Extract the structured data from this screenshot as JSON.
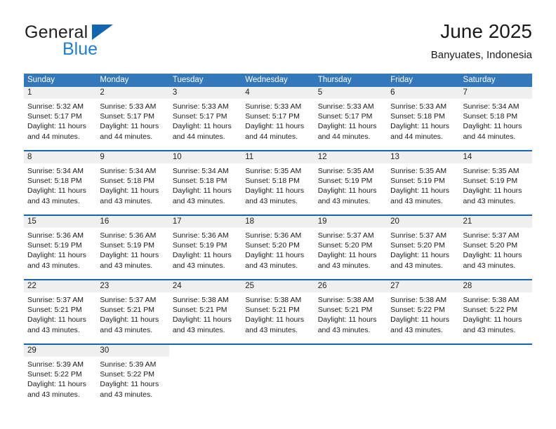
{
  "brand": {
    "name_part1": "General",
    "name_part2": "Blue",
    "flag_icon": "triangle-flag-icon"
  },
  "header": {
    "title": "June 2025",
    "location": "Banyuates, Indonesia"
  },
  "calendar": {
    "weekday_headers": [
      "Sunday",
      "Monday",
      "Tuesday",
      "Wednesday",
      "Thursday",
      "Friday",
      "Saturday"
    ],
    "accent_color": "#3478bc",
    "row_border_color": "#1266b0",
    "daynum_bg_color": "#efefef",
    "weeks": [
      [
        {
          "day": "1",
          "sunrise": "Sunrise: 5:32 AM",
          "sunset": "Sunset: 5:17 PM",
          "daylight": "Daylight: 11 hours and 44 minutes."
        },
        {
          "day": "2",
          "sunrise": "Sunrise: 5:33 AM",
          "sunset": "Sunset: 5:17 PM",
          "daylight": "Daylight: 11 hours and 44 minutes."
        },
        {
          "day": "3",
          "sunrise": "Sunrise: 5:33 AM",
          "sunset": "Sunset: 5:17 PM",
          "daylight": "Daylight: 11 hours and 44 minutes."
        },
        {
          "day": "4",
          "sunrise": "Sunrise: 5:33 AM",
          "sunset": "Sunset: 5:17 PM",
          "daylight": "Daylight: 11 hours and 44 minutes."
        },
        {
          "day": "5",
          "sunrise": "Sunrise: 5:33 AM",
          "sunset": "Sunset: 5:17 PM",
          "daylight": "Daylight: 11 hours and 44 minutes."
        },
        {
          "day": "6",
          "sunrise": "Sunrise: 5:33 AM",
          "sunset": "Sunset: 5:18 PM",
          "daylight": "Daylight: 11 hours and 44 minutes."
        },
        {
          "day": "7",
          "sunrise": "Sunrise: 5:34 AM",
          "sunset": "Sunset: 5:18 PM",
          "daylight": "Daylight: 11 hours and 44 minutes."
        }
      ],
      [
        {
          "day": "8",
          "sunrise": "Sunrise: 5:34 AM",
          "sunset": "Sunset: 5:18 PM",
          "daylight": "Daylight: 11 hours and 43 minutes."
        },
        {
          "day": "9",
          "sunrise": "Sunrise: 5:34 AM",
          "sunset": "Sunset: 5:18 PM",
          "daylight": "Daylight: 11 hours and 43 minutes."
        },
        {
          "day": "10",
          "sunrise": "Sunrise: 5:34 AM",
          "sunset": "Sunset: 5:18 PM",
          "daylight": "Daylight: 11 hours and 43 minutes."
        },
        {
          "day": "11",
          "sunrise": "Sunrise: 5:35 AM",
          "sunset": "Sunset: 5:18 PM",
          "daylight": "Daylight: 11 hours and 43 minutes."
        },
        {
          "day": "12",
          "sunrise": "Sunrise: 5:35 AM",
          "sunset": "Sunset: 5:19 PM",
          "daylight": "Daylight: 11 hours and 43 minutes."
        },
        {
          "day": "13",
          "sunrise": "Sunrise: 5:35 AM",
          "sunset": "Sunset: 5:19 PM",
          "daylight": "Daylight: 11 hours and 43 minutes."
        },
        {
          "day": "14",
          "sunrise": "Sunrise: 5:35 AM",
          "sunset": "Sunset: 5:19 PM",
          "daylight": "Daylight: 11 hours and 43 minutes."
        }
      ],
      [
        {
          "day": "15",
          "sunrise": "Sunrise: 5:36 AM",
          "sunset": "Sunset: 5:19 PM",
          "daylight": "Daylight: 11 hours and 43 minutes."
        },
        {
          "day": "16",
          "sunrise": "Sunrise: 5:36 AM",
          "sunset": "Sunset: 5:19 PM",
          "daylight": "Daylight: 11 hours and 43 minutes."
        },
        {
          "day": "17",
          "sunrise": "Sunrise: 5:36 AM",
          "sunset": "Sunset: 5:19 PM",
          "daylight": "Daylight: 11 hours and 43 minutes."
        },
        {
          "day": "18",
          "sunrise": "Sunrise: 5:36 AM",
          "sunset": "Sunset: 5:20 PM",
          "daylight": "Daylight: 11 hours and 43 minutes."
        },
        {
          "day": "19",
          "sunrise": "Sunrise: 5:37 AM",
          "sunset": "Sunset: 5:20 PM",
          "daylight": "Daylight: 11 hours and 43 minutes."
        },
        {
          "day": "20",
          "sunrise": "Sunrise: 5:37 AM",
          "sunset": "Sunset: 5:20 PM",
          "daylight": "Daylight: 11 hours and 43 minutes."
        },
        {
          "day": "21",
          "sunrise": "Sunrise: 5:37 AM",
          "sunset": "Sunset: 5:20 PM",
          "daylight": "Daylight: 11 hours and 43 minutes."
        }
      ],
      [
        {
          "day": "22",
          "sunrise": "Sunrise: 5:37 AM",
          "sunset": "Sunset: 5:21 PM",
          "daylight": "Daylight: 11 hours and 43 minutes."
        },
        {
          "day": "23",
          "sunrise": "Sunrise: 5:37 AM",
          "sunset": "Sunset: 5:21 PM",
          "daylight": "Daylight: 11 hours and 43 minutes."
        },
        {
          "day": "24",
          "sunrise": "Sunrise: 5:38 AM",
          "sunset": "Sunset: 5:21 PM",
          "daylight": "Daylight: 11 hours and 43 minutes."
        },
        {
          "day": "25",
          "sunrise": "Sunrise: 5:38 AM",
          "sunset": "Sunset: 5:21 PM",
          "daylight": "Daylight: 11 hours and 43 minutes."
        },
        {
          "day": "26",
          "sunrise": "Sunrise: 5:38 AM",
          "sunset": "Sunset: 5:21 PM",
          "daylight": "Daylight: 11 hours and 43 minutes."
        },
        {
          "day": "27",
          "sunrise": "Sunrise: 5:38 AM",
          "sunset": "Sunset: 5:22 PM",
          "daylight": "Daylight: 11 hours and 43 minutes."
        },
        {
          "day": "28",
          "sunrise": "Sunrise: 5:38 AM",
          "sunset": "Sunset: 5:22 PM",
          "daylight": "Daylight: 11 hours and 43 minutes."
        }
      ],
      [
        {
          "day": "29",
          "sunrise": "Sunrise: 5:39 AM",
          "sunset": "Sunset: 5:22 PM",
          "daylight": "Daylight: 11 hours and 43 minutes."
        },
        {
          "day": "30",
          "sunrise": "Sunrise: 5:39 AM",
          "sunset": "Sunset: 5:22 PM",
          "daylight": "Daylight: 11 hours and 43 minutes."
        },
        {
          "day": "",
          "sunrise": "",
          "sunset": "",
          "daylight": ""
        },
        {
          "day": "",
          "sunrise": "",
          "sunset": "",
          "daylight": ""
        },
        {
          "day": "",
          "sunrise": "",
          "sunset": "",
          "daylight": ""
        },
        {
          "day": "",
          "sunrise": "",
          "sunset": "",
          "daylight": ""
        },
        {
          "day": "",
          "sunrise": "",
          "sunset": "",
          "daylight": ""
        }
      ]
    ]
  }
}
